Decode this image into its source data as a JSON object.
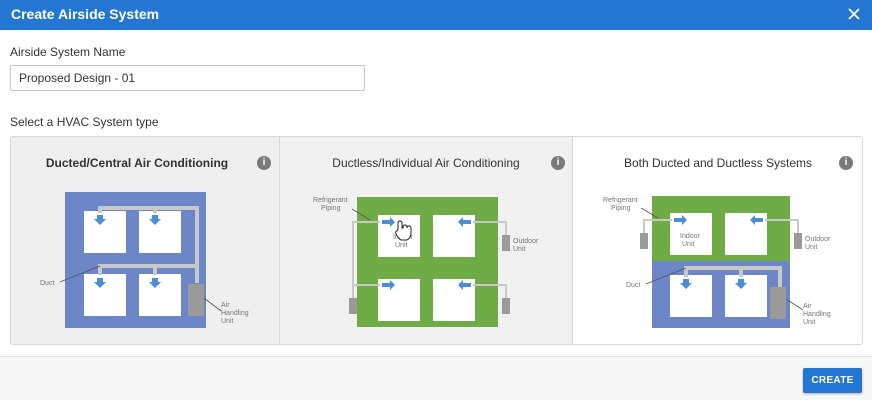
{
  "dialog": {
    "title": "Create Airside System",
    "close_icon": "close-icon"
  },
  "form": {
    "name_label": "Airside System Name",
    "name_value": "Proposed Design - 01",
    "type_label": "Select a HVAC System type"
  },
  "options": [
    {
      "title": "Ducted/Central Air Conditioning",
      "selected": true,
      "labels": {
        "duct": "Duct",
        "ahu_1": "Air",
        "ahu_2": "Handling",
        "ahu_3": "Unit"
      }
    },
    {
      "title": "Ductless/Individual Air Conditioning",
      "selected": false,
      "labels": {
        "ref_1": "Refrigerant",
        "ref_2": "Piping",
        "indoor_1": "Indoor",
        "indoor_2": "Unit",
        "outdoor_1": "Outdoor",
        "outdoor_2": "Unit"
      }
    },
    {
      "title": "Both Ducted and Ductless Systems",
      "selected": false,
      "labels": {
        "ref_1": "Refrigerant",
        "ref_2": "Piping",
        "indoor_1": "Indoor",
        "indoor_2": "Unit",
        "outdoor_1": "Outdoor",
        "outdoor_2": "Unit",
        "duct": "Duct",
        "ahu_1": "Air",
        "ahu_2": "Handling",
        "ahu_3": "Unit"
      }
    }
  ],
  "info_icon_text": "i",
  "footer": {
    "create_label": "CREATE"
  },
  "colors": {
    "accent": "#2377d3",
    "ducted_fill": "#6d86c7",
    "ductless_fill": "#6fac46",
    "arrow": "#4a8fd6"
  }
}
